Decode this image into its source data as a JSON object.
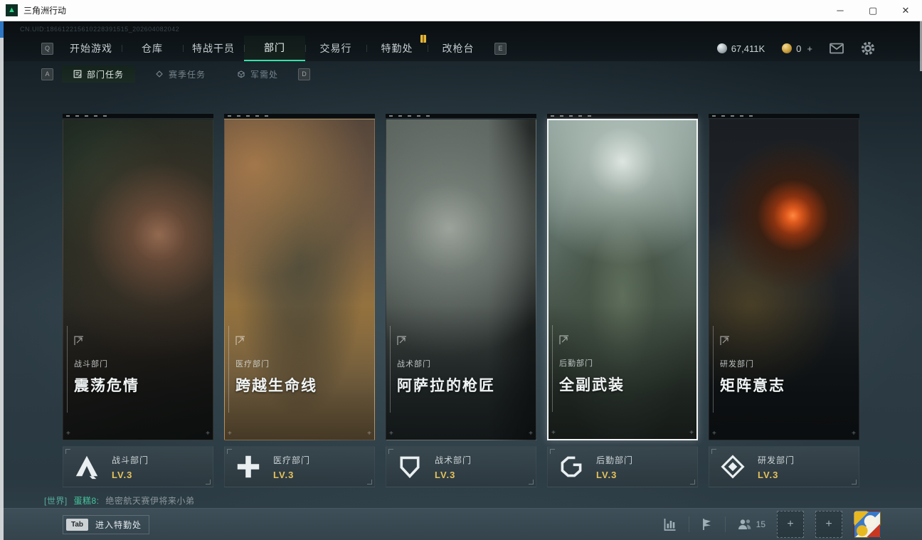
{
  "window": {
    "title": "三角洲行动"
  },
  "uid": "CN.UID:186612215610228391515_202604082042",
  "icons": {
    "minimize": "─",
    "maximize": "▢",
    "close": "✕",
    "logo_triangle": "▲",
    "plus": "+"
  },
  "top_nav": {
    "prev_key": "Q",
    "next_key": "E",
    "tabs": [
      {
        "label": "开始游戏"
      },
      {
        "label": "仓库"
      },
      {
        "label": "特战干员"
      },
      {
        "label": "部门",
        "active": true
      },
      {
        "label": "交易行"
      },
      {
        "label": "特勤处",
        "badge": true
      },
      {
        "label": "改枪台"
      }
    ]
  },
  "currency": {
    "primary": {
      "icon": "silver-coin",
      "value": "67,411K"
    },
    "premium": {
      "icon": "gold-coin",
      "value": "0",
      "suffix": "+"
    }
  },
  "sub_nav": {
    "prev_key": "A",
    "next_key": "D",
    "tabs": [
      {
        "label": "部门任务",
        "icon": "dept-tasks-icon",
        "active": true
      },
      {
        "label": "赛季任务",
        "icon": "season-tasks-icon",
        "active": false
      },
      {
        "label": "军需处",
        "icon": "quartermaster-icon",
        "active": false
      }
    ]
  },
  "cards": [
    {
      "dept": "战斗部门",
      "title": "震荡危情",
      "level": "LV.3",
      "icon": "combat-dept-icon",
      "selected": false
    },
    {
      "dept": "医疗部门",
      "title": "跨越生命线",
      "level": "LV.3",
      "icon": "medical-dept-icon",
      "selected": false
    },
    {
      "dept": "战术部门",
      "title": "阿萨拉的枪匠",
      "level": "LV.3",
      "icon": "tactical-dept-icon",
      "selected": false
    },
    {
      "dept": "后勤部门",
      "title": "全副武装",
      "level": "LV.3",
      "icon": "logistics-dept-icon",
      "selected": true
    },
    {
      "dept": "研发部门",
      "title": "矩阵意志",
      "level": "LV.3",
      "icon": "rnd-dept-icon",
      "selected": false
    }
  ],
  "chat": {
    "channel": "[世界]",
    "user": "蛋糕8:",
    "message": "绝密航天赛伊将来小弟"
  },
  "bottom_bar": {
    "key": "Tab",
    "enter_label": "进入特勤处",
    "online_count": "15"
  },
  "colors": {
    "accent_teal": "#36e2a8",
    "level_gold": "#e4c25c",
    "badge_gold": "#e3b83c"
  }
}
